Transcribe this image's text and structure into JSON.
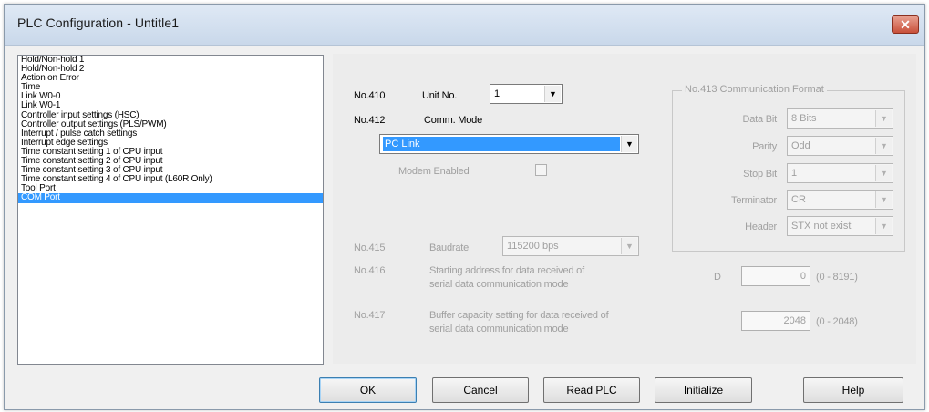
{
  "window": {
    "title": "PLC Configuration - Untitle1",
    "close_glyph": "✕"
  },
  "nav_list": {
    "items": [
      "Hold/Non-hold 1",
      "Hold/Non-hold 2",
      "Action on Error",
      "Time",
      "Link W0-0",
      "Link W0-1",
      "Controller input settings (HSC)",
      "Controller output settings (PLS/PWM)",
      "Interrupt / pulse catch settings",
      "Interrupt edge settings",
      "Time constant setting 1 of CPU input",
      "Time constant setting 2 of CPU input",
      "Time constant setting 3 of CPU input",
      "Time constant setting 4 of CPU input (L60R Only)",
      "Tool Port",
      "COM Port"
    ],
    "selected_index": 15
  },
  "settings": {
    "no410": {
      "label": "No.410",
      "field": "Unit No.",
      "value": "1"
    },
    "no412": {
      "label": "No.412",
      "field": "Comm. Mode",
      "value": "PC Link"
    },
    "modem": {
      "label": "Modem Enabled",
      "checked": false
    },
    "no413": {
      "title": "No.413 Communication Format",
      "data_bit": {
        "label": "Data Bit",
        "value": "8 Bits"
      },
      "parity": {
        "label": "Parity",
        "value": "Odd"
      },
      "stop_bit": {
        "label": "Stop Bit",
        "value": "1"
      },
      "terminator": {
        "label": "Terminator",
        "value": "CR"
      },
      "header": {
        "label": "Header",
        "value": "STX not exist"
      }
    },
    "no415": {
      "label": "No.415",
      "field": "Baudrate",
      "value": "115200 bps"
    },
    "no416": {
      "label": "No.416",
      "desc_line1": "Starting address for data received of",
      "desc_line2": "serial data communication mode",
      "prefix": "D",
      "value": "0",
      "range": "(0 - 8191)"
    },
    "no417": {
      "label": "No.417",
      "desc_line1": "Buffer capacity setting for data received of",
      "desc_line2": "serial data communication mode",
      "value": "2048",
      "range": "(0 - 2048)"
    }
  },
  "buttons": {
    "ok": "OK",
    "cancel": "Cancel",
    "read_plc": "Read PLC",
    "initialize": "Initialize",
    "help": "Help"
  },
  "icons": {
    "dropdown": "▼",
    "checkbox": "☐"
  },
  "colors": {
    "selection": "#3399ff",
    "close_button": "#c8503a"
  }
}
